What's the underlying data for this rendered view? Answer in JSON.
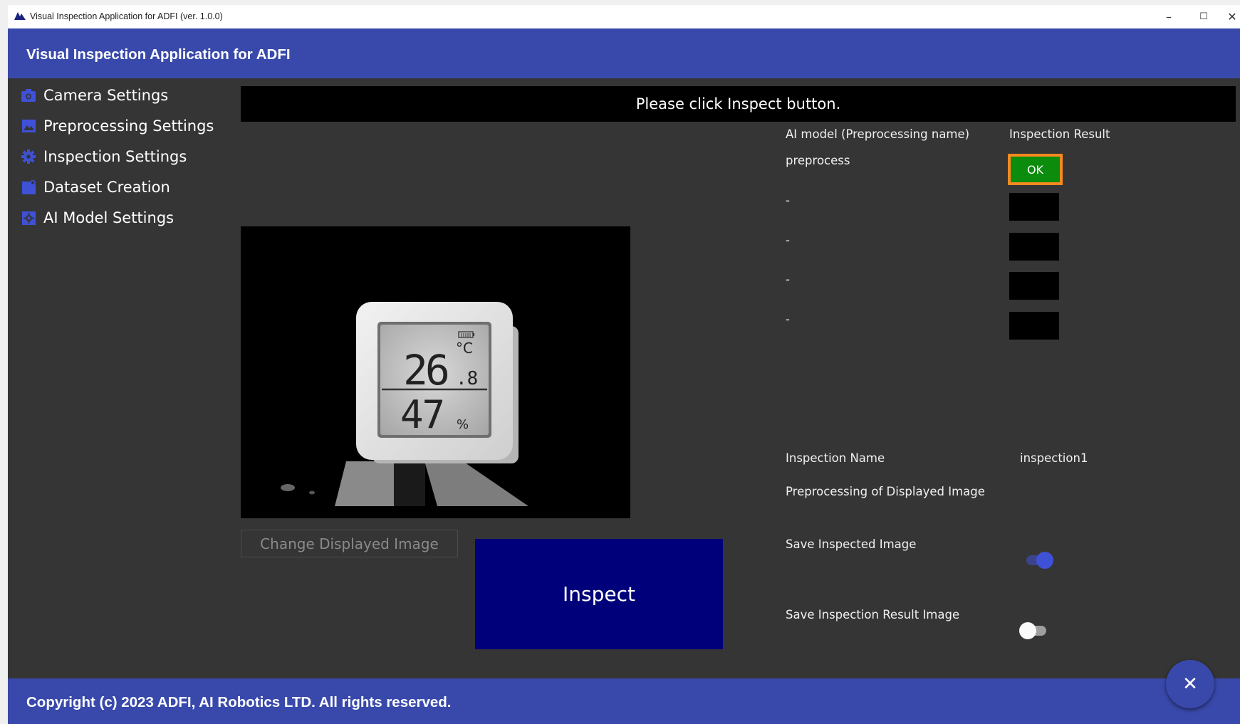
{
  "titlebar": {
    "title": "Visual Inspection Application for ADFI (ver. 1.0.0)",
    "minimize": "–",
    "maximize": "☐",
    "close": "✕"
  },
  "header": {
    "title": "Visual Inspection Application for ADFI"
  },
  "sidebar": {
    "items": [
      {
        "label": "Camera Settings",
        "icon": "camera-icon"
      },
      {
        "label": "Preprocessing Settings",
        "icon": "image-icon"
      },
      {
        "label": "Inspection Settings",
        "icon": "gear-icon"
      },
      {
        "label": "Dataset Creation",
        "icon": "dataset-icon"
      },
      {
        "label": "AI Model Settings",
        "icon": "ai-settings-icon"
      }
    ]
  },
  "message": "Please click Inspect button.",
  "results": {
    "model_header": "AI model (Preprocessing name)",
    "result_header": "Inspection Result",
    "rows": [
      {
        "model": "preprocess",
        "result": "OK"
      },
      {
        "model": "-",
        "result": ""
      },
      {
        "model": "-",
        "result": ""
      },
      {
        "model": "-",
        "result": ""
      },
      {
        "model": "-",
        "result": ""
      }
    ]
  },
  "camera": {
    "display_temp": "26",
    "display_temp_decimal": ".8",
    "display_temp_unit": "°C",
    "display_humidity": "47",
    "display_humidity_unit": "%"
  },
  "buttons": {
    "change_image": "Change Displayed Image",
    "inspect": "Inspect",
    "fab_close": "✕"
  },
  "settings": {
    "inspection_name_label": "Inspection Name",
    "inspection_name_value": "inspection1",
    "preprocessing_label": "Preprocessing of Displayed Image",
    "save_inspected_label": "Save Inspected Image",
    "save_inspected_on": true,
    "save_result_label": "Save Inspection Result Image",
    "save_result_on": false
  },
  "footer": {
    "copyright": "Copyright (c) 2023 ADFI, AI Robotics LTD. All rights reserved."
  },
  "colors": {
    "accent": "#3949ab",
    "inspect_button": "#00007a",
    "ok_fill": "#0c8c0c",
    "ok_border": "#f6891f",
    "toggle_on": "#3f51d6"
  }
}
